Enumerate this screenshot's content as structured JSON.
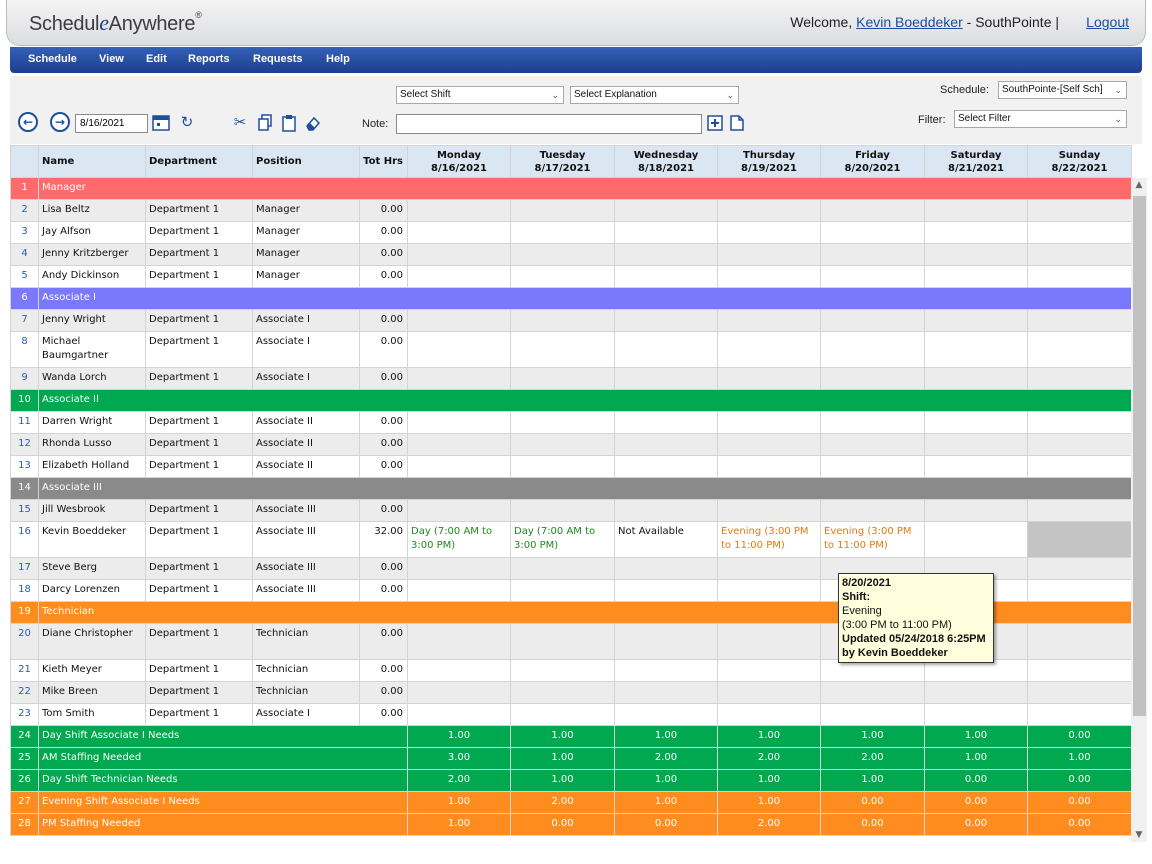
{
  "header": {
    "logo": {
      "schedule": "Schedul",
      "e": "e",
      "anywhere": "Anywhere",
      "reg": "®"
    },
    "welcome_prefix": "Welcome, ",
    "user_name": "Kevin Boeddeker",
    "welcome_suffix": " - SouthPointe | ",
    "logout": "Logout"
  },
  "menu": [
    "Schedule",
    "View",
    "Edit",
    "Reports",
    "Requests",
    "Help"
  ],
  "toolbar": {
    "select_shift": "Select Shift",
    "select_explanation": "Select Explanation",
    "schedule_label": "Schedule:",
    "schedule_value": "SouthPointe-[Self Sch]",
    "filter_label": "Filter:",
    "filter_value": "Select Filter",
    "date_value": "8/16/2021",
    "note_label": "Note:",
    "note_value": ""
  },
  "columns": {
    "name": "Name",
    "department": "Department",
    "position": "Position",
    "tot_hrs": "Tot Hrs",
    "days": [
      {
        "day": "Monday",
        "date": "8/16/2021"
      },
      {
        "day": "Tuesday",
        "date": "8/17/2021"
      },
      {
        "day": "Wednesday",
        "date": "8/18/2021"
      },
      {
        "day": "Thursday",
        "date": "8/19/2021"
      },
      {
        "day": "Friday",
        "date": "8/20/2021"
      },
      {
        "day": "Saturday",
        "date": "8/21/2021"
      },
      {
        "day": "Sunday",
        "date": "8/22/2021"
      }
    ]
  },
  "rows": [
    {
      "n": "1",
      "type": "group",
      "label": "Manager",
      "color": "#ff6a6a"
    },
    {
      "n": "2",
      "type": "emp",
      "name": "Lisa Beltz",
      "dept": "Department 1",
      "pos": "Manager",
      "tot": "0.00"
    },
    {
      "n": "3",
      "type": "emp",
      "name": "Jay Alfson",
      "dept": "Department 1",
      "pos": "Manager",
      "tot": "0.00"
    },
    {
      "n": "4",
      "type": "emp",
      "name": "Jenny Kritzberger",
      "dept": "Department 1",
      "pos": "Manager",
      "tot": "0.00"
    },
    {
      "n": "5",
      "type": "emp",
      "name": "Andy Dickinson",
      "dept": "Department 1",
      "pos": "Manager",
      "tot": "0.00"
    },
    {
      "n": "6",
      "type": "group",
      "label": "Associate I",
      "color": "#7b79fb"
    },
    {
      "n": "7",
      "type": "emp",
      "name": "Jenny Wright",
      "dept": "Department 1",
      "pos": "Associate I",
      "tot": "0.00"
    },
    {
      "n": "8",
      "type": "emp",
      "name": "Michael Baumgartner",
      "dept": "Department 1",
      "pos": "Associate I",
      "tot": "0.00",
      "tall": true
    },
    {
      "n": "9",
      "type": "emp",
      "name": "Wanda Lorch",
      "dept": "Department 1",
      "pos": "Associate I",
      "tot": "0.00"
    },
    {
      "n": "10",
      "type": "group",
      "label": "Associate II",
      "color": "#00a84f"
    },
    {
      "n": "11",
      "type": "emp",
      "name": "Darren Wright",
      "dept": "Department 1",
      "pos": "Associate II",
      "tot": "0.00"
    },
    {
      "n": "12",
      "type": "emp",
      "name": "Rhonda Lusso",
      "dept": "Department 1",
      "pos": "Associate II",
      "tot": "0.00"
    },
    {
      "n": "13",
      "type": "emp",
      "name": "Elizabeth Holland",
      "dept": "Department 1",
      "pos": "Associate II",
      "tot": "0.00"
    },
    {
      "n": "14",
      "type": "group",
      "label": "Associate III",
      "color": "#8a8a8a"
    },
    {
      "n": "15",
      "type": "emp",
      "name": "Jill Wesbrook",
      "dept": "Department 1",
      "pos": "Associate III",
      "tot": "0.00"
    },
    {
      "n": "16",
      "type": "emp",
      "name": "Kevin Boeddeker",
      "dept": "Department 1",
      "pos": "Associate III",
      "tot": "32.00",
      "tall": true,
      "cells": [
        {
          "text": "Day (7:00 AM to 3:00 PM)",
          "kind": "day"
        },
        {
          "text": "Day (7:00 AM to 3:00 PM)",
          "kind": "day"
        },
        {
          "text": "Not Available",
          "kind": "na"
        },
        {
          "text": "Evening (3:00 PM to 11:00 PM)",
          "kind": "eve"
        },
        {
          "text": "Evening (3:00 PM to 11:00 PM)",
          "kind": "eve"
        },
        {
          "text": "",
          "kind": ""
        },
        {
          "text": "",
          "kind": "unav"
        }
      ]
    },
    {
      "n": "17",
      "type": "emp",
      "name": "Steve Berg",
      "dept": "Department 1",
      "pos": "Associate III",
      "tot": "0.00"
    },
    {
      "n": "18",
      "type": "emp",
      "name": "Darcy Lorenzen",
      "dept": "Department 1",
      "pos": "Associate III",
      "tot": "0.00"
    },
    {
      "n": "19",
      "type": "group",
      "label": "Technician",
      "color": "#ff8c1f"
    },
    {
      "n": "20",
      "type": "emp",
      "name": "Diane Christopher",
      "dept": "Department 1",
      "pos": "Technician",
      "tot": "0.00",
      "tall": true
    },
    {
      "n": "21",
      "type": "emp",
      "name": "Kieth Meyer",
      "dept": "Department 1",
      "pos": "Technician",
      "tot": "0.00"
    },
    {
      "n": "22",
      "type": "emp",
      "name": "Mike Breen",
      "dept": "Department 1",
      "pos": "Technician",
      "tot": "0.00"
    },
    {
      "n": "23",
      "type": "emp",
      "name": "Tom Smith",
      "dept": "Department 1",
      "pos": "Associate I",
      "tot": "0.00"
    },
    {
      "n": "24",
      "type": "stat",
      "label": "Day Shift Associate I Needs",
      "color": "#00a84f",
      "values": [
        "1.00",
        "1.00",
        "1.00",
        "1.00",
        "1.00",
        "1.00",
        "0.00"
      ]
    },
    {
      "n": "25",
      "type": "stat",
      "label": "AM Staffing Needed",
      "color": "#00a84f",
      "values": [
        "3.00",
        "1.00",
        "2.00",
        "2.00",
        "2.00",
        "1.00",
        "1.00"
      ]
    },
    {
      "n": "26",
      "type": "stat",
      "label": "Day Shift Technician Needs",
      "color": "#00a84f",
      "values": [
        "2.00",
        "1.00",
        "1.00",
        "1.00",
        "1.00",
        "0.00",
        "0.00"
      ]
    },
    {
      "n": "27",
      "type": "stat",
      "label": "Evening Shift Associate I Needs",
      "color": "#ff8c1f",
      "values": [
        "1.00",
        "2.00",
        "1.00",
        "1.00",
        "0.00",
        "0.00",
        "0.00"
      ]
    },
    {
      "n": "28",
      "type": "stat",
      "label": "PM Staffing Needed",
      "color": "#ff8c1f",
      "values": [
        "1.00",
        "0.00",
        "0.00",
        "2.00",
        "0.00",
        "0.00",
        "0.00"
      ]
    }
  ],
  "tooltip": {
    "date": "8/20/2021",
    "shift_label": "Shift:",
    "shift_name": "Evening",
    "shift_time": "(3:00 PM to 11:00 PM)",
    "updated": "Updated 05/24/2018 6:25PM",
    "by": "by Kevin Boeddeker"
  },
  "icons": {
    "prev": "arrow-left-circle-icon",
    "next": "arrow-right-circle-icon",
    "calendar": "calendar-icon",
    "refresh": "refresh-icon",
    "cut": "scissors-icon",
    "copy": "copy-icon",
    "paste": "clipboard-icon",
    "erase": "eraser-icon",
    "note_add": "note-add-icon",
    "note": "note-icon"
  }
}
